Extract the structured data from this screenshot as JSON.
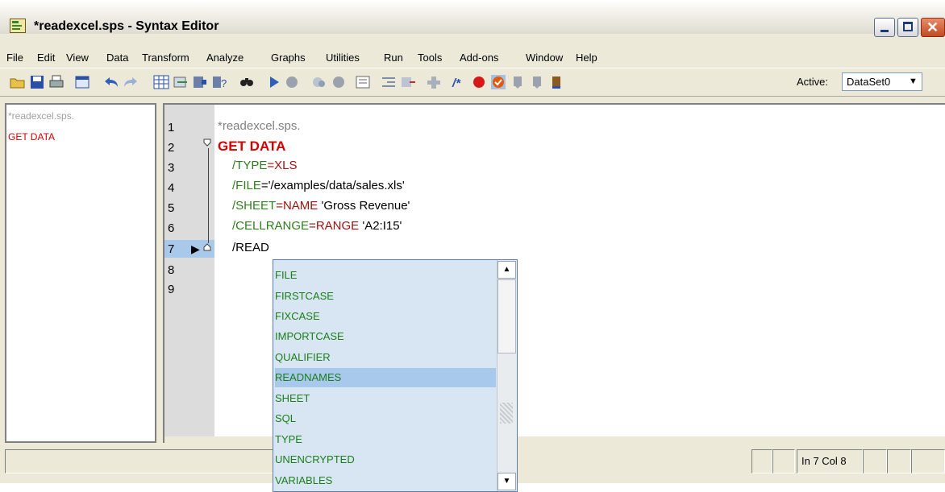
{
  "window": {
    "title": "*readexcel.sps - Syntax Editor"
  },
  "menu": [
    "File",
    "Edit",
    "View",
    "Data",
    "Transform",
    "Analyze",
    "Graphs",
    "Utilities",
    "Run",
    "Tools",
    "Add-ons",
    "Window",
    "Help"
  ],
  "toolbar": {
    "icons": [
      "open-icon",
      "save-icon",
      "print-icon",
      "recall-dialog-icon",
      "undo-icon",
      "redo-icon",
      "data-editor-icon",
      "go-to-case-icon",
      "variables-icon",
      "variable-info-icon",
      "find-icon",
      "run-selection-icon",
      "stop-icon",
      "breakpoint-icon",
      "clear-breakpoints-icon",
      "show-line-numbers-icon",
      "indent-icon",
      "outdent-icon",
      "comment-icon",
      "uncomment-icon",
      "bookmark-icon",
      "next-bookmark-icon",
      "prev-bookmark-icon",
      "clear-bookmarks-icon"
    ],
    "active_label": "Active:",
    "active_dataset": "DataSet0"
  },
  "nav": {
    "title": "*readexcel.sps.",
    "items": [
      "GET DATA"
    ]
  },
  "editor": {
    "line_numbers": [
      "1",
      "2",
      "3",
      "4",
      "5",
      "6",
      "7",
      "8",
      "9"
    ],
    "current_line": 7,
    "lines": {
      "l1": "*readexcel.sps.",
      "l2": "GET DATA",
      "l3_kw": "/TYPE",
      "l3_eq": "=",
      "l3_val": "XLS",
      "l4_kw": "/FILE",
      "l4_rest": "='/examples/data/sales.xls'",
      "l5_kw": "/SHEET",
      "l5_eq": "=",
      "l5_val": "NAME",
      "l5_rest": " 'Gross Revenue'",
      "l6_kw": "/CELLRANGE",
      "l6_eq": "=",
      "l6_val": "RANGE",
      "l6_rest": " 'A2:I15'",
      "l7": "/READ"
    }
  },
  "autocomplete": {
    "items": [
      "FILE",
      "FIRSTCASE",
      "FIXCASE",
      "IMPORTCASE",
      "QUALIFIER",
      "READNAMES",
      "SHEET",
      "SQL",
      "TYPE",
      "UNENCRYPTED",
      "VARIABLES"
    ],
    "selected": "READNAMES"
  },
  "status": {
    "position": "In 7 Col 8"
  }
}
